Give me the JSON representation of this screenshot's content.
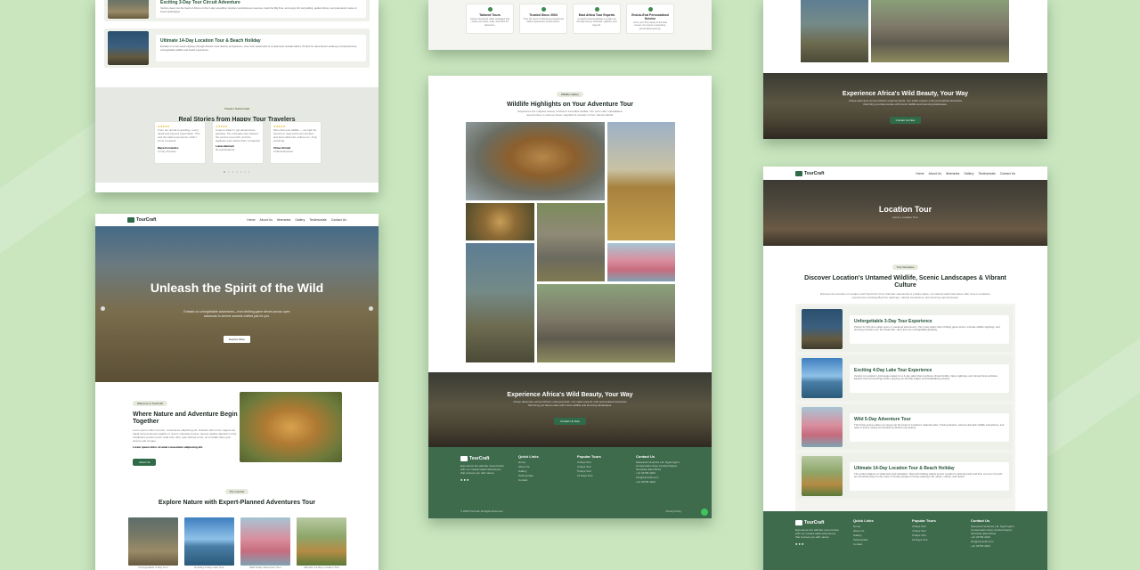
{
  "colors": {
    "background": "#c9e6bf",
    "brand_green": "#2f6b48",
    "footer_green": "#3f6b4d",
    "title_green": "#27533a"
  },
  "brand": {
    "name": "TourCraft",
    "logo_icon": "tree-logo-icon"
  },
  "nav": {
    "home": "Home",
    "about": "About Us",
    "itineraries": "Itineraries",
    "gallery": "Gallery",
    "testimonials": "Testimonials",
    "contact": "Contact Us"
  },
  "mock_a": {
    "tour_top_title": "Exciting 3-Day Tour Circuit Adventure",
    "tour_top_desc": "Venture deep into the heart of Africa on this 3-day expedition. Explore world-famous reserves, track the Big Five, and enjoy rich storytelling, guided drives, and panoramic views of iconic landscapes.",
    "tour_card_title": "Ultimate 14-Day Location Tour & Beach Holiday",
    "tour_card_desc": "Embark on a two-week odyssey through Africa's most diverse ecosystems—from lush savannahs to crystal-clear coastal waters. Perfect for adventurers seeking a comprehensive, unforgettable wildlife and beach experience.",
    "testimonials_badge": "Traveler Testimonials",
    "testimonials_title": "Real Stories from Happy Tour Travelers",
    "reviews": [
      {
        "stars": "★★★★★",
        "text": "From our arrival to goodbye, every detail was beyond expectation. This was the safari experience I didn't know I needed!",
        "name": "Maya Fernandes",
        "role": "Luxury Traveler"
      },
      {
        "stars": "★★★★★",
        "text": "It was a dream! I got adventurous getaway. The schedule was relaxed, the service top-notch, and the sightings were better than I imagined!",
        "name": "Lucas Bennett",
        "role": "Nomad Explorer"
      },
      {
        "stars": "★★★★★",
        "text": "More than just wildlife — we had the chance to meet local communities and learn about the culture too. Truly enriching.",
        "name": "Chloe Ahmed",
        "role": "Cultural Explorer"
      }
    ]
  },
  "mock_b": {
    "hero_title": "Unleash the Spirit of the Wild",
    "hero_desc": "Embark on unforgettable adventures—from thrilling game drives across open savannas to serene sunsets crafted just for you.",
    "hero_button": "Explore More",
    "welcome_badge": "Welcome to TourCraft",
    "about_title": "Where Nature and Adventure Begin Together",
    "about_desc": "Lorem ipsum dolor sit amet, consectetur adipiscing elit. Proident odio tortor magna nisi, fugiat tempus laoreet sagittis et. Ipsum vulputate tempor, laoreet sagittis dignissim tortor. Vestibulum pretium proin nulla ante nibh, quis ultricies tortor. Ut convallis diam quis viverra velit congue.",
    "about_highlight": "Lorem ipsum dolor sit amet consectetur adipiscing elit.",
    "about_button": "About Us",
    "tours_badge": "The Comfort",
    "tours_title": "Explore Nature with Expert-Planned Adventures Tour",
    "tour_thumbs": [
      "Unforgettable 3-Day Tour",
      "Exciting 4-Day Lake Tour",
      "Wild 5-Day Adventure Tour",
      "Ultimate 14-Day Location Tour"
    ]
  },
  "mock_c": {
    "features": [
      {
        "title": "Tailored Tours",
        "desc": "Custom-designed safari packages that match your pace, style, and thirst for adventure."
      },
      {
        "title": "Trusted Since 2004",
        "desc": "Over 20 years of delivering exceptional safari experiences across Africa."
      },
      {
        "title": "East Africa Tour Experts",
        "desc": "In-depth local knowledge to guide you through Kenya, Tanzania, Uganda, and beyond."
      },
      {
        "title": "End-to-End Personalised Service",
        "desc": "From your first inquiry to the final sunset, we ensure a seamless, personalized journey."
      }
    ]
  },
  "mock_d": {
    "gallery_badge": "Wildlife Gallery",
    "gallery_title": "Wildlife Highlights on Your Adventure Tour",
    "gallery_desc": "Experience the majestic beauty of Africa's incredible wildlife. Our tours offer unparalleled opportunities to observe these magnificent animals in their natural habitat.",
    "cta_title": "Experience Africa's Wild Beauty, Your Way",
    "cta_desc": "Chase adventure across Africa's untamed lands. Our safari experts craft personalized itineraries that bring you face-to-face with iconic wildlife and stunning landscapes.",
    "cta_button": "Contact Us Now",
    "footer": {
      "about": "Experience the wild like never before with our curated safari adventures that connect you with nature.",
      "quick_links_title": "Quick Links",
      "quick_links": [
        "Home",
        "About Us",
        "Gallery",
        "Testimonials",
        "Contact"
      ],
      "popular_title": "Popular Tours",
      "popular": [
        "3 Days Tour",
        "4 Days Tour",
        "5 Days Tour",
        "14 Days Tour"
      ],
      "contact_title": "Contact Us",
      "address": "Savannah Ventures Ltd, Ngorongoro Conservation Area, Arusha Region, Tanzania, East Africa",
      "phone": "+12 34756 4220",
      "email": "info@tourcraft.com",
      "phone2": "+12 34756 4220",
      "copyright": "© 2025 TourCraft. All Rights Reserved.",
      "privacy": "Privacy Policy"
    }
  },
  "mock_e": {
    "cta_title": "Experience Africa's Wild Beauty, Your Way",
    "cta_desc": "Chase adventure across Africa's untamed lands. Our safari experts craft personalized itineraries that bring you face-to-face with iconic wildlife and stunning landscapes.",
    "cta_button": "Contact Us Now"
  },
  "mock_f": {
    "page_title": "Location Tour",
    "breadcrumb": "Home  |  Location Tour",
    "badge": "Tour Itineraries",
    "section_title": "Discover Location's Untamed Wildlife, Scenic Landscapes & Vibrant Culture",
    "section_desc": "Discover the wonders of Location with TourCraft. From dramatic savannahs to pristine lakes, our tailored safari itineraries offer once-in-a-lifetime experiences including Big Five sightings, cultural interactions, and stunning natural beauty.",
    "tours": [
      {
        "title": "Unforgettable 3-Day Tour Experience",
        "desc": "Perfect for first-time safari goers or weekend adventurers, this 3-day safari offers thrilling game drives, intimate wildlife sightings, and stunning sunrises over the savannah—all in just one unforgettable getaway."
      },
      {
        "title": "Exciting 4-Day Lake Tour Experience",
        "desc": "Venture to Location's picturesque lakes for a 4-day safari that combines vibrant birdlife, hippo sightings, and tranquil boat activities. Explore lush surroundings while enjoying eco-friendly lodges and breathtaking sunsets."
      },
      {
        "title": "Wild 5-Day Adventure Tour",
        "desc": "This 5-day journey takes you deep into the heart of Location's national parks. Track predators, witness dramatic wildlife interactions, and relax in luxury camps surrounded by Africa's raw beauty."
      },
      {
        "title": "Ultimate 14-Day Location Tour & Beach Holiday",
        "desc": "The perfect balance of wilderness and relaxation. Start with thrilling safaris across Location's national parks and then end your trip with ten wonderful days on the coast. A 14-day escape for those seeking it all: nature, culture, and beach."
      }
    ],
    "footer": {
      "about": "Experience the wild like never before with our curated safari adventures that connect you with nature.",
      "quick_links_title": "Quick Links",
      "quick_links": [
        "Home",
        "About Us",
        "Gallery",
        "Testimonials",
        "Contact"
      ],
      "popular_title": "Popular Tours",
      "popular": [
        "3 Days Tour",
        "4 Days Tour",
        "5 Days Tour",
        "14 Days Tour"
      ],
      "contact_title": "Contact Us",
      "address": "Savannah Ventures Ltd, Ngorongoro Conservation Area, Arusha Region, Tanzania, East Africa",
      "phone": "+12 34756 4220",
      "email": "info@tourcraft.com",
      "phone2": "+12 34756 4220"
    }
  }
}
